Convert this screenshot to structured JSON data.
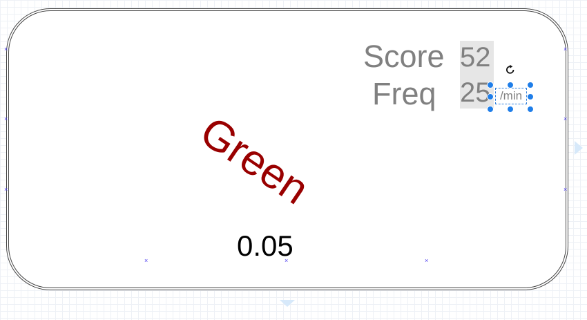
{
  "diagram": {
    "score_label": "Score",
    "score_value": "52",
    "freq_label": "Freq",
    "freq_value": "25",
    "unit_label": "/min",
    "rotated_text": "Green",
    "value_text": "0.05",
    "colors": {
      "label_gray": "#808080",
      "value_bg": "#e6e6e6",
      "rotated_text": "#990000",
      "selection": "#1f7ee9",
      "connection_point": "#4c3cf0"
    },
    "icons": [
      "rotate-icon",
      "connection-point-icon",
      "expand-arrow-icon"
    ]
  }
}
